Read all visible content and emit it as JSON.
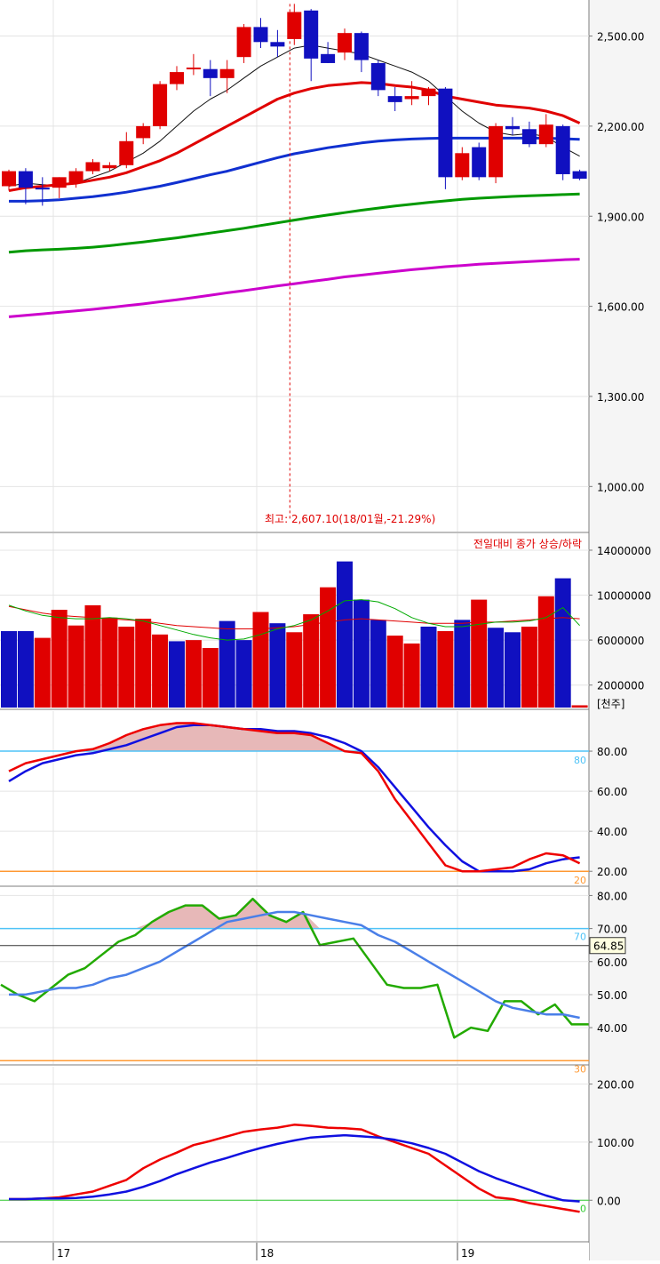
{
  "chart_data": [
    {
      "type": "candlestick",
      "panel": "price",
      "ylim": [
        850,
        2620
      ],
      "y_ticks": [
        1000,
        1300,
        1600,
        1900,
        2200,
        2500
      ],
      "y_tick_labels": [
        "1,000.00",
        "1,300.00",
        "1,600.00",
        "1,900.00",
        "2,200.00",
        "2,500.00"
      ],
      "x_tick_labels": [
        "17",
        "18",
        "19"
      ],
      "annotation": "최고: 2,607.10(18/01월,-21.29%)",
      "candles": [
        {
          "o": 2000,
          "h": 2055,
          "l": 1985,
          "c": 2050
        },
        {
          "o": 2050,
          "h": 2060,
          "l": 1940,
          "c": 1995
        },
        {
          "o": 1995,
          "h": 2030,
          "l": 1935,
          "c": 1990
        },
        {
          "o": 1995,
          "h": 2030,
          "l": 1960,
          "c": 2030
        },
        {
          "o": 2010,
          "h": 2060,
          "l": 1995,
          "c": 2050
        },
        {
          "o": 2050,
          "h": 2090,
          "l": 2040,
          "c": 2080
        },
        {
          "o": 2060,
          "h": 2080,
          "l": 2050,
          "c": 2070
        },
        {
          "o": 2070,
          "h": 2180,
          "l": 2060,
          "c": 2150
        },
        {
          "o": 2160,
          "h": 2210,
          "l": 2140,
          "c": 2200
        },
        {
          "o": 2200,
          "h": 2350,
          "l": 2190,
          "c": 2340
        },
        {
          "o": 2340,
          "h": 2400,
          "l": 2320,
          "c": 2380
        },
        {
          "o": 2390,
          "h": 2440,
          "l": 2370,
          "c": 2395
        },
        {
          "o": 2390,
          "h": 2420,
          "l": 2300,
          "c": 2360
        },
        {
          "o": 2360,
          "h": 2420,
          "l": 2310,
          "c": 2390
        },
        {
          "o": 2430,
          "h": 2540,
          "l": 2410,
          "c": 2530
        },
        {
          "o": 2530,
          "h": 2560,
          "l": 2460,
          "c": 2480
        },
        {
          "o": 2480,
          "h": 2520,
          "l": 2430,
          "c": 2465
        },
        {
          "o": 2490,
          "h": 2607.1,
          "l": 2470,
          "c": 2580
        },
        {
          "o": 2585,
          "h": 2590,
          "l": 2350,
          "c": 2425
        },
        {
          "o": 2440,
          "h": 2480,
          "l": 2410,
          "c": 2410
        },
        {
          "o": 2445,
          "h": 2525,
          "l": 2420,
          "c": 2510
        },
        {
          "o": 2510,
          "h": 2515,
          "l": 2380,
          "c": 2420
        },
        {
          "o": 2410,
          "h": 2420,
          "l": 2300,
          "c": 2320
        },
        {
          "o": 2300,
          "h": 2330,
          "l": 2250,
          "c": 2280
        },
        {
          "o": 2290,
          "h": 2350,
          "l": 2270,
          "c": 2300
        },
        {
          "o": 2300,
          "h": 2330,
          "l": 2270,
          "c": 2325
        },
        {
          "o": 2325,
          "h": 2330,
          "l": 1990,
          "c": 2030
        },
        {
          "o": 2030,
          "h": 2130,
          "l": 2020,
          "c": 2110
        },
        {
          "o": 2130,
          "h": 2145,
          "l": 2020,
          "c": 2030
        },
        {
          "o": 2030,
          "h": 2210,
          "l": 2010,
          "c": 2200
        },
        {
          "o": 2200,
          "h": 2230,
          "l": 2170,
          "c": 2190
        },
        {
          "o": 2190,
          "h": 2215,
          "l": 2130,
          "c": 2140
        },
        {
          "o": 2140,
          "h": 2240,
          "l": 2130,
          "c": 2205
        },
        {
          "o": 2200,
          "h": 2205,
          "l": 2020,
          "c": 2040
        },
        {
          "o": 2050,
          "h": 2055,
          "l": 2020,
          "c": 2025
        }
      ],
      "moving_averages": [
        {
          "color": "#111111",
          "values": [
            2000,
            2010,
            2005,
            2002,
            2010,
            2030,
            2050,
            2080,
            2110,
            2150,
            2200,
            2250,
            2290,
            2320,
            2360,
            2400,
            2430,
            2460,
            2470,
            2460,
            2450,
            2440,
            2420,
            2400,
            2380,
            2350,
            2300,
            2250,
            2210,
            2180,
            2170,
            2175,
            2165,
            2130,
            2100
          ]
        },
        {
          "color": "#e00000",
          "values": [
            1985,
            1995,
            2000,
            2005,
            2010,
            2020,
            2030,
            2045,
            2065,
            2085,
            2110,
            2140,
            2170,
            2200,
            2230,
            2260,
            2290,
            2310,
            2325,
            2335,
            2340,
            2345,
            2342,
            2335,
            2330,
            2320,
            2300,
            2290,
            2280,
            2270,
            2265,
            2260,
            2250,
            2235,
            2210
          ]
        },
        {
          "color": "#1030d0",
          "values": [
            1950,
            1950,
            1952,
            1955,
            1960,
            1965,
            1972,
            1980,
            1990,
            2000,
            2012,
            2025,
            2038,
            2050,
            2065,
            2080,
            2095,
            2108,
            2118,
            2128,
            2136,
            2144,
            2150,
            2154,
            2157,
            2159,
            2160,
            2160,
            2160,
            2160,
            2160,
            2160,
            2160,
            2158,
            2156
          ]
        },
        {
          "color": "#009900",
          "values": [
            1780,
            1785,
            1788,
            1790,
            1793,
            1797,
            1802,
            1808,
            1814,
            1821,
            1828,
            1836,
            1844,
            1852,
            1860,
            1869,
            1878,
            1887,
            1896,
            1904,
            1912,
            1920,
            1927,
            1934,
            1940,
            1946,
            1951,
            1956,
            1960,
            1963,
            1966,
            1968,
            1970,
            1972,
            1974
          ]
        },
        {
          "color": "#cc00cc",
          "values": [
            1565,
            1570,
            1575,
            1580,
            1585,
            1590,
            1596,
            1602,
            1608,
            1615,
            1622,
            1629,
            1637,
            1645,
            1652,
            1660,
            1668,
            1675,
            1683,
            1690,
            1698,
            1704,
            1710,
            1716,
            1722,
            1727,
            1732,
            1736,
            1740,
            1743,
            1746,
            1749,
            1752,
            1755,
            1757
          ]
        }
      ]
    },
    {
      "type": "bar",
      "panel": "volume",
      "legend_text": "전일대비 종가 상승/하락",
      "ylim": [
        0,
        15500000
      ],
      "y_ticks": [
        2000000,
        6000000,
        10000000,
        14000000
      ],
      "y_tick_labels": [
        "2000000",
        "6000000",
        "10000000",
        "14000000"
      ],
      "unit_label": "[천주]",
      "values": [
        6800000,
        6800000,
        6200000,
        8700000,
        7300000,
        9100000,
        8000000,
        7200000,
        7900000,
        6500000,
        5900000,
        6000000,
        5300000,
        7700000,
        6000000,
        8500000,
        7500000,
        6700000,
        8300000,
        10700000,
        13000000,
        9600000,
        7800000,
        6400000,
        5700000,
        7200000,
        6800000,
        7800000,
        9600000,
        7100000,
        6700000,
        7200000,
        9900000,
        11500000,
        200000
      ],
      "bar_colors": [
        "#1010c0",
        "#1010c0",
        "#e00000",
        "#e00000",
        "#e00000",
        "#e00000",
        "#e00000",
        "#e00000",
        "#e00000",
        "#e00000",
        "#1010c0",
        "#e00000",
        "#e00000",
        "#1010c0",
        "#1010c0",
        "#e00000",
        "#1010c0",
        "#e00000",
        "#e00000",
        "#e00000",
        "#1010c0",
        "#1010c0",
        "#1010c0",
        "#e00000",
        "#e00000",
        "#1010c0",
        "#e00000",
        "#1010c0",
        "#e00000",
        "#1010c0",
        "#1010c0",
        "#e00000",
        "#e00000",
        "#1010c0",
        "#e00000"
      ],
      "lines": [
        {
          "color": "#e00000",
          "values": [
            9000000,
            8700000,
            8400000,
            8200000,
            8100000,
            8000000,
            7900000,
            7800000,
            7700000,
            7500000,
            7300000,
            7200000,
            7100000,
            7000000,
            7000000,
            7000000,
            7100000,
            7200000,
            7400000,
            7600000,
            7800000,
            7900000,
            7800000,
            7700000,
            7600000,
            7500000,
            7500000,
            7500000,
            7600000,
            7600000,
            7700000,
            7800000,
            7900000,
            8000000,
            7900000
          ]
        },
        {
          "color": "#00aa00",
          "values": [
            9100000,
            8600000,
            8200000,
            8000000,
            7900000,
            7900000,
            8000000,
            7900000,
            7700000,
            7300000,
            6900000,
            6500000,
            6200000,
            6000000,
            6100000,
            6500000,
            7000000,
            7300000,
            7800000,
            8600000,
            9500000,
            9600000,
            9400000,
            8800000,
            8000000,
            7500000,
            7200000,
            7200000,
            7400000,
            7600000,
            7600000,
            7700000,
            8000000,
            8900000,
            7300000
          ]
        }
      ]
    },
    {
      "type": "line",
      "panel": "stochastic",
      "ylim": [
        13,
        100
      ],
      "y_ticks": [
        20,
        40,
        60,
        80
      ],
      "y_tick_labels": [
        "20.00",
        "40.00",
        "60.00",
        "80.00"
      ],
      "reference_lines": [
        {
          "value": 80,
          "label": "80"
        },
        {
          "value": 20,
          "label": "20"
        }
      ],
      "series": [
        {
          "color": "#1010e0",
          "values": [
            65,
            70,
            74,
            76,
            78,
            79,
            81,
            83,
            86,
            89,
            92,
            93,
            93,
            92,
            91,
            91,
            90,
            90,
            89,
            87,
            84,
            80,
            72,
            62,
            52,
            42,
            33,
            25,
            20,
            20,
            20,
            21,
            24,
            26,
            27
          ]
        },
        {
          "color": "#ee0000",
          "values": [
            70,
            74,
            76,
            78,
            80,
            81,
            84,
            88,
            91,
            93,
            94,
            94,
            93,
            92,
            91,
            90,
            89,
            89,
            88,
            84,
            80,
            79,
            70,
            56,
            45,
            34,
            23,
            20,
            20,
            21,
            22,
            26,
            29,
            28,
            24
          ]
        }
      ]
    },
    {
      "type": "line",
      "panel": "rsi",
      "ylim": [
        29,
        82
      ],
      "y_ticks": [
        40,
        50,
        60,
        70,
        80
      ],
      "y_tick_labels": [
        "40.00",
        "50.00",
        "60.00",
        "70.00",
        "80.00"
      ],
      "reference_lines": [
        {
          "value": 70,
          "label": "70"
        },
        {
          "value": 30,
          "label": "30"
        }
      ],
      "current_value": "64.85",
      "series": [
        {
          "color": "#22aa00",
          "values": [
            53,
            50,
            48,
            52,
            56,
            58,
            62,
            66,
            68,
            72,
            75,
            77,
            77,
            73,
            74,
            79,
            74,
            72,
            75,
            65,
            66,
            67,
            60,
            53,
            52,
            52,
            53,
            37,
            40,
            39,
            48,
            48,
            44,
            47,
            41,
            41
          ]
        },
        {
          "color": "#4a7fe8",
          "values": [
            50,
            50,
            51,
            52,
            52,
            53,
            55,
            56,
            58,
            60,
            63,
            66,
            69,
            72,
            73,
            74,
            75,
            75,
            74,
            73,
            72,
            71,
            68,
            66,
            63,
            60,
            57,
            54,
            51,
            48,
            46,
            45,
            44,
            44,
            43
          ]
        }
      ]
    },
    {
      "type": "line",
      "panel": "macd",
      "ylim": [
        -70,
        230
      ],
      "y_ticks": [
        0,
        100,
        200
      ],
      "y_tick_labels": [
        "0.00",
        "100.00",
        "200.00"
      ],
      "reference_lines": [
        {
          "value": 0,
          "label": "0"
        }
      ],
      "series": [
        {
          "color": "#ee0000",
          "values": [
            2,
            2,
            3,
            5,
            10,
            15,
            25,
            35,
            55,
            70,
            82,
            95,
            102,
            110,
            118,
            122,
            125,
            130,
            128,
            125,
            124,
            122,
            110,
            100,
            90,
            80,
            60,
            40,
            20,
            5,
            2,
            -5,
            -10,
            -15,
            -20
          ]
        },
        {
          "color": "#1010e0",
          "values": [
            2,
            2,
            3,
            3,
            4,
            6,
            10,
            15,
            23,
            33,
            45,
            55,
            65,
            73,
            82,
            90,
            97,
            103,
            108,
            110,
            112,
            110,
            108,
            104,
            98,
            90,
            80,
            65,
            50,
            38,
            28,
            18,
            8,
            0,
            -2
          ]
        }
      ]
    }
  ]
}
